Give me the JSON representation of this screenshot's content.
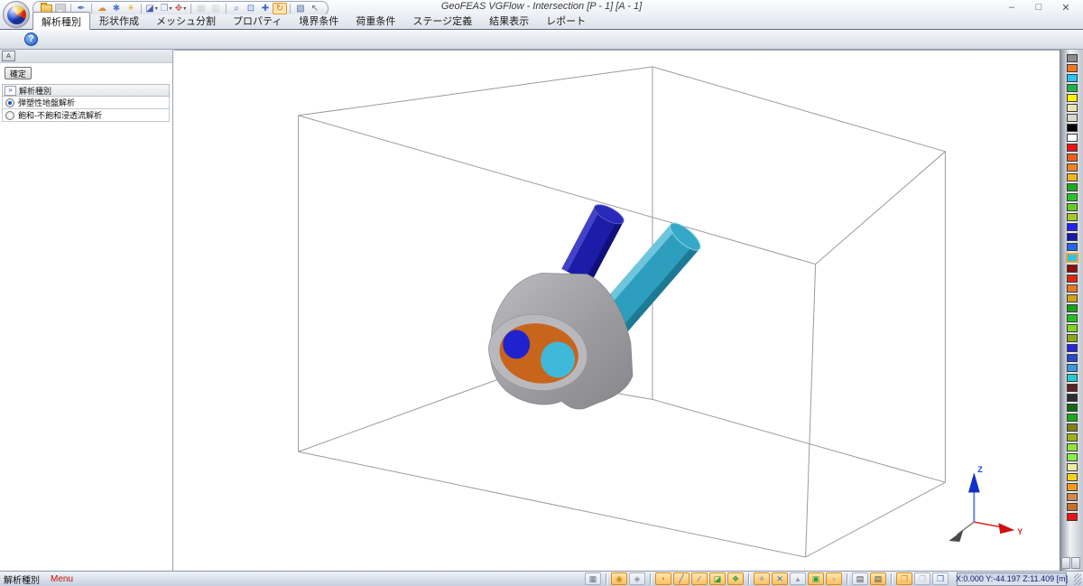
{
  "window": {
    "title": "GeoFEAS VGFlow - Intersection [P - 1] [A - 1]",
    "controls": {
      "minimize": "–",
      "maximize": "□",
      "close": "✕"
    }
  },
  "quick_access_toolbar": {
    "icons": [
      {
        "name": "open-file",
        "shape": "folder"
      },
      {
        "name": "save-file",
        "shape": "floppy",
        "disabled": true
      },
      {
        "separator": true
      },
      {
        "name": "pushpin",
        "glyph": "✒",
        "color": "#3A6BC8"
      },
      {
        "separator": true
      },
      {
        "name": "render-shaded",
        "glyph": "☁",
        "color": "#E08838"
      },
      {
        "name": "render-settings",
        "glyph": "✱",
        "color": "#4A7BD0"
      },
      {
        "name": "render-light",
        "glyph": "☀",
        "color": "#E8B820"
      },
      {
        "separator": true
      },
      {
        "name": "view-cube",
        "glyph": "◪",
        "color": "#4A5BB5",
        "dropdown": true
      },
      {
        "name": "view-copy",
        "glyph": "❐",
        "color": "#7B93C9",
        "dropdown": true
      },
      {
        "name": "view-direction",
        "glyph": "✥",
        "color": "#C85B5B",
        "dropdown": true
      },
      {
        "separator": true
      },
      {
        "name": "snapshot",
        "glyph": "▦",
        "color": "#9AA2AE",
        "disabled": true
      },
      {
        "name": "snapshot-copy",
        "glyph": "▥",
        "color": "#9AA2AE",
        "disabled": true
      },
      {
        "separator": true
      },
      {
        "name": "zoom",
        "glyph": "⌕",
        "color": "#3A6BC8"
      },
      {
        "name": "zoom-window",
        "glyph": "⊡",
        "color": "#3A6BC8"
      },
      {
        "name": "pan",
        "glyph": "✚",
        "color": "#3A6BC8"
      },
      {
        "name": "rotate",
        "glyph": "↻",
        "color": "#E07818",
        "active": true
      },
      {
        "separator": true
      },
      {
        "name": "select-region",
        "glyph": "▧",
        "color": "#4A6B9C"
      },
      {
        "name": "select-cursor",
        "glyph": "↖",
        "color": "#4A6B9C"
      }
    ]
  },
  "ribbon": {
    "help_label": "?",
    "tabs": [
      {
        "label": "解析種別",
        "active": true
      },
      {
        "label": "形状作成",
        "active": false
      },
      {
        "label": "メッシュ分割",
        "active": false
      },
      {
        "label": "プロパティ",
        "active": false
      },
      {
        "label": "境界条件",
        "active": false
      },
      {
        "label": "荷重条件",
        "active": false
      },
      {
        "label": "ステージ定義",
        "active": false
      },
      {
        "label": "結果表示",
        "active": false
      },
      {
        "label": "レポート",
        "active": false
      }
    ]
  },
  "left_panel": {
    "mini_icon_label": "A",
    "confirm_label": "確定",
    "group_header": {
      "chevron": "»",
      "label": "解析種別"
    },
    "options": [
      {
        "label": "弾塑性地盤解析",
        "selected": true
      },
      {
        "label": "飽和-不飽和浸透流解析",
        "selected": false
      }
    ]
  },
  "viewport": {
    "axis": {
      "z": "Z",
      "y": "Y"
    }
  },
  "color_palette": {
    "selected_index": 20,
    "colors": [
      "#8C8C8C",
      "#F07820",
      "#29C5F2",
      "#22B14C",
      "#FFF200",
      "#EFE4B0",
      "#D9D9C9",
      "#000000",
      "#FFFFFF",
      "#E81416",
      "#F25C1E",
      "#F58220",
      "#EFB520",
      "#1FA81F",
      "#2CC22C",
      "#66CC22",
      "#A8C822",
      "#2222EE",
      "#1818A8",
      "#2266EE",
      "#29C5F2",
      "#8C1010",
      "#E02810",
      "#E87820",
      "#D4A017",
      "#18A018",
      "#22C022",
      "#7CD622",
      "#8CA814",
      "#2626E0",
      "#2A48C8",
      "#3C96E0",
      "#22CCCC",
      "#5C2424",
      "#2E2E2E",
      "#156815",
      "#1CA81C",
      "#7C8410",
      "#9CB414",
      "#94E434",
      "#86F146",
      "#ECEC9E",
      "#F2D21E",
      "#F29A1E",
      "#D2884A",
      "#C87028",
      "#E81410"
    ]
  },
  "status_bar": {
    "left_label": "解析種別",
    "menu_label": "Menu",
    "coordinates": "X:0.000 Y:-44.197 Z:11.409 [m]",
    "tool_groups": [
      {
        "icons": [
          {
            "name": "grid-view",
            "glyph": "▦",
            "color": "#6B7684",
            "active": false
          }
        ]
      },
      {
        "icons": [
          {
            "name": "snap-toggle",
            "glyph": "◉",
            "color": "#C89010",
            "active": true
          },
          {
            "name": "lock-toggle",
            "glyph": "◈",
            "color": "#8A93A0",
            "active": false
          }
        ]
      },
      {
        "icons": [
          {
            "name": "draw-point",
            "glyph": "•",
            "color": "#C89010",
            "active": true
          },
          {
            "name": "draw-line",
            "glyph": "╱",
            "color": "#3A6BC8",
            "active": true
          },
          {
            "name": "draw-polyline",
            "glyph": "∕",
            "color": "#3A6BC8",
            "active": true
          },
          {
            "name": "draw-surface",
            "glyph": "◪",
            "color": "#2F9E44",
            "active": true
          },
          {
            "name": "draw-solid",
            "glyph": "❖",
            "color": "#2F9E44",
            "active": true
          }
        ]
      },
      {
        "icons": [
          {
            "name": "select-node",
            "glyph": "✧",
            "color": "#3A6BC8",
            "active": true
          },
          {
            "name": "select-edge",
            "glyph": "✕",
            "color": "#3A6BC8",
            "active": true
          },
          {
            "name": "select-face",
            "glyph": "▴",
            "color": "#8A93A0",
            "active": false
          },
          {
            "name": "show-solid",
            "glyph": "▣",
            "color": "#2F9E44",
            "active": true
          },
          {
            "name": "show-mesh",
            "glyph": "▫",
            "color": "#6B7684",
            "active": true
          }
        ]
      },
      {
        "icons": [
          {
            "name": "print-view",
            "glyph": "▤",
            "color": "#444444",
            "active": false
          },
          {
            "name": "print-view-alt",
            "glyph": "▤",
            "color": "#444444",
            "active": true
          }
        ]
      },
      {
        "icons": [
          {
            "name": "layout-single",
            "glyph": "❐",
            "color": "#C89010",
            "active": true
          },
          {
            "name": "layout-split",
            "glyph": "❐",
            "color": "#B8BEC8",
            "active": false
          },
          {
            "name": "layout-quad",
            "glyph": "❐",
            "color": "#3A6BC8",
            "active": false
          }
        ]
      }
    ]
  }
}
